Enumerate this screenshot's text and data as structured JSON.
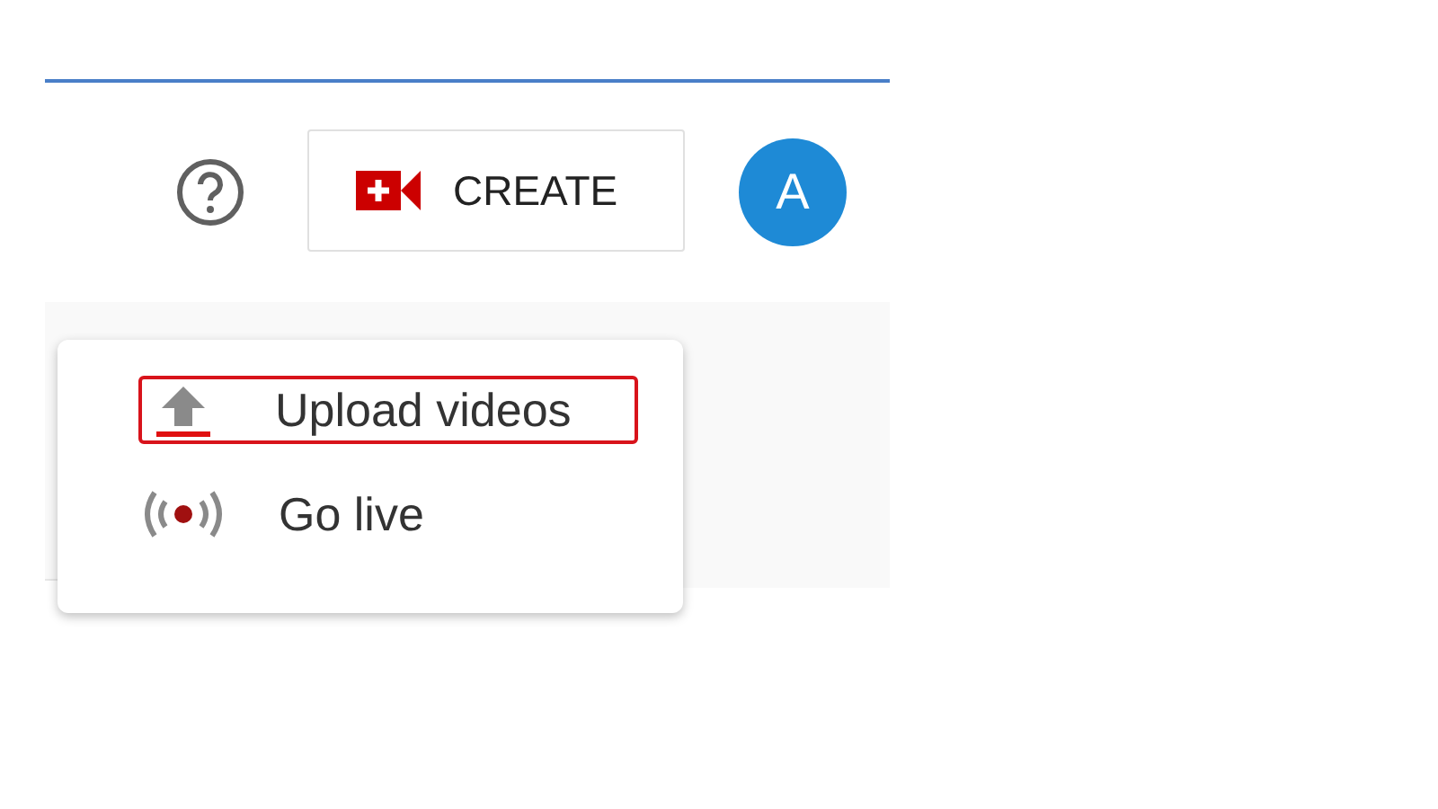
{
  "header": {
    "create_button": {
      "label": "CREATE"
    },
    "avatar": {
      "letter": "A"
    }
  },
  "create_menu": {
    "items": [
      {
        "kind": "upload",
        "label": "Upload videos",
        "selected": true
      },
      {
        "kind": "live",
        "label": "Go live",
        "selected": false
      }
    ]
  }
}
